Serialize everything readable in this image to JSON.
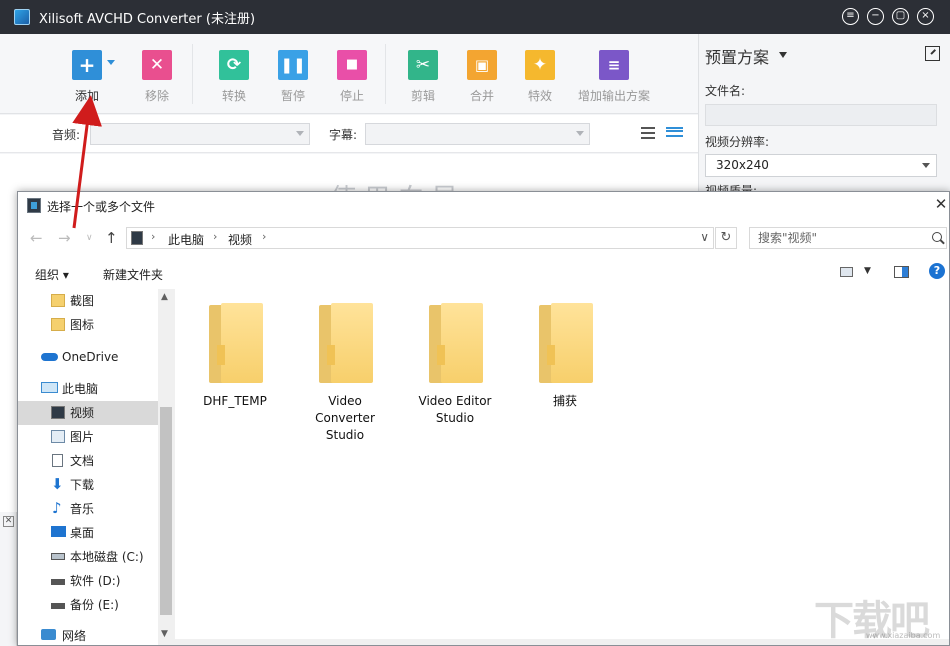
{
  "app": {
    "title": "Xilisoft AVCHD Converter (未注册)",
    "window_buttons": [
      "≡",
      "−",
      "▢",
      "×"
    ]
  },
  "toolbar": {
    "add": "添加",
    "remove": "移除",
    "convert": "转换",
    "pause": "暂停",
    "stop": "停止",
    "cut": "剪辑",
    "merge": "合并",
    "effects": "特效",
    "add_profile": "增加输出方案"
  },
  "subbar": {
    "audio_label": "音频:",
    "subtitle_label": "字幕:"
  },
  "main": {
    "hint": "使用向导"
  },
  "preset": {
    "title": "预置方案",
    "filename_label": "文件名:",
    "resolution_label": "视频分辨率:",
    "resolution_value": "320x240",
    "quality_label": "视频质量:"
  },
  "dialog": {
    "title": "选择一个或多个文件",
    "breadcrumb": [
      "此电脑",
      "视频"
    ],
    "search_placeholder": "搜索\"视频\"",
    "organize": "组织",
    "new_folder": "新建文件夹",
    "nav": [
      {
        "label": "截图",
        "icon": "folder-icon"
      },
      {
        "label": "图标",
        "icon": "folder-icon"
      },
      {
        "label": "OneDrive",
        "icon": "cloud-icon"
      },
      {
        "label": "此电脑",
        "icon": "computer-icon"
      },
      {
        "label": "视频",
        "icon": "video-icon"
      },
      {
        "label": "图片",
        "icon": "pictures-icon"
      },
      {
        "label": "文档",
        "icon": "documents-icon"
      },
      {
        "label": "下载",
        "icon": "download-icon"
      },
      {
        "label": "音乐",
        "icon": "music-icon"
      },
      {
        "label": "桌面",
        "icon": "desktop-icon"
      },
      {
        "label": "本地磁盘 (C:)",
        "icon": "drive-icon"
      },
      {
        "label": "软件 (D:)",
        "icon": "drive-icon"
      },
      {
        "label": "备份 (E:)",
        "icon": "drive-icon"
      },
      {
        "label": "网络",
        "icon": "network-icon"
      }
    ],
    "files": [
      {
        "name": "DHF_TEMP"
      },
      {
        "name": "Video Converter Studio"
      },
      {
        "name": "Video Editor Studio"
      },
      {
        "name": "捕获"
      }
    ]
  },
  "watermark": {
    "text": "下载吧",
    "url": "www.xiazaiba.com"
  }
}
